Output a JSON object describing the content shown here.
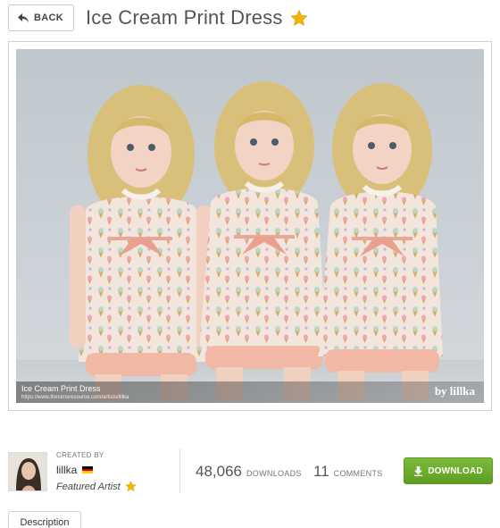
{
  "header": {
    "back_label": "BACK",
    "title": "Ice Cream Print Dress"
  },
  "image": {
    "caption_title": "Ice Cream Print Dress",
    "caption_url": "https://www.thesimsresource.com/artists/lillka",
    "brand": "by lillka"
  },
  "creator": {
    "created_by_label": "CREATED BY",
    "name": "lillka",
    "country_flag": "germany-flag",
    "featured_label": "Featured Artist"
  },
  "stats": {
    "downloads_count": "48,066",
    "downloads_label": "DOWNLOADS",
    "comments_count": "11",
    "comments_label": "COMMENTS"
  },
  "download_button": {
    "label": "DOWNLOAD"
  },
  "tabs": [
    {
      "label": "Description"
    }
  ],
  "colors": {
    "star": "#f2b600",
    "download_green": "#6aab2c",
    "text_gray": "#555555"
  },
  "icons": [
    "back-arrow-icon",
    "star-icon",
    "download-icon"
  ]
}
